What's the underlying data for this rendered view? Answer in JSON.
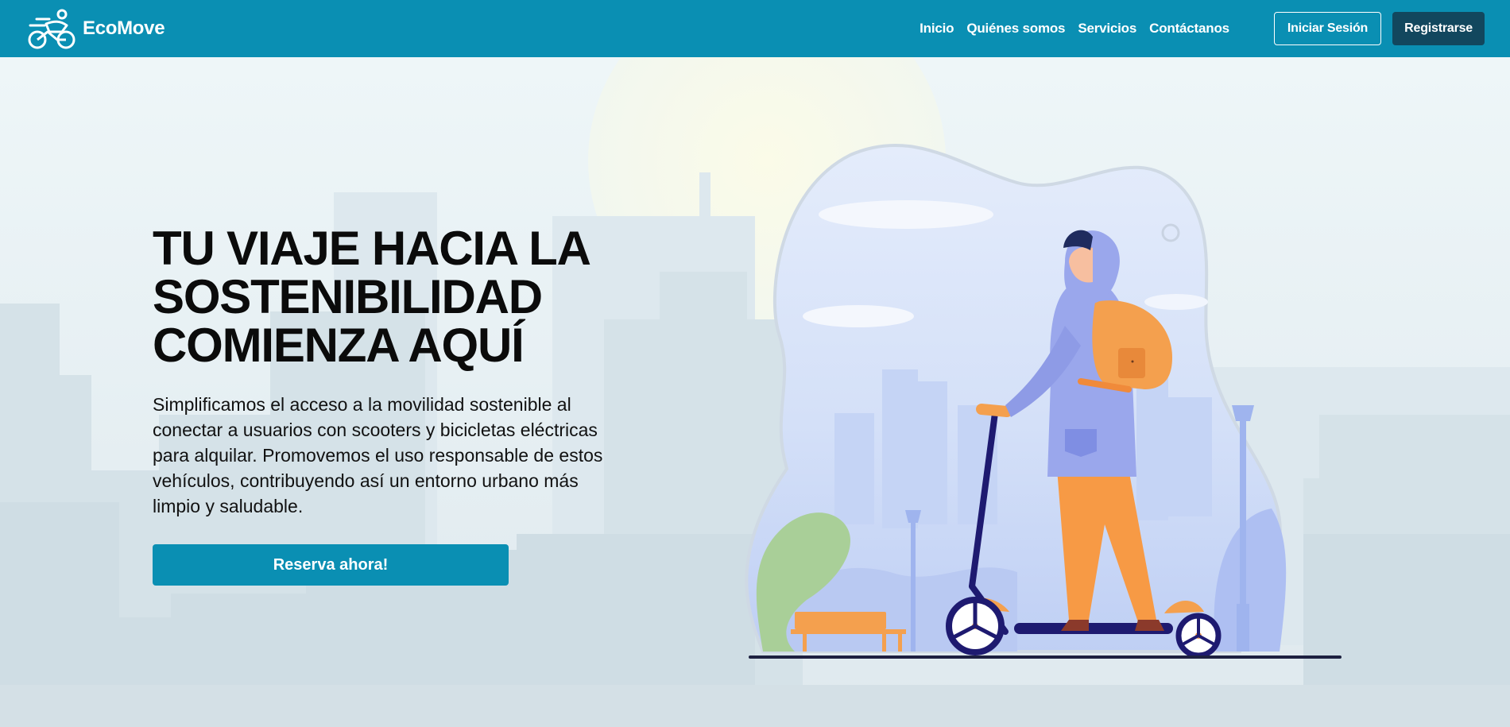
{
  "navbar": {
    "brand_name": "EcoMove",
    "links": [
      "Inicio",
      "Quiénes somos",
      "Servicios",
      "Contáctanos"
    ],
    "login_label": "Iniciar Sesión",
    "register_label": "Registrarse"
  },
  "hero": {
    "title_lines": [
      "TU VIAJE HACIA LA",
      "SOSTENIBILIDAD",
      "COMIENZA AQUÍ"
    ],
    "description": "Simplificamos el acceso a la movilidad sostenible al conectar a usuarios con scooters y bicicletas eléctricas para alquilar. Promovemos el uso responsable de estos vehículos, contribuyendo así un entorno urbano más limpio y saludable.",
    "cta_label": "Reserva ahora!"
  },
  "colors": {
    "primary": "#0a8fb3",
    "dark": "#12475e",
    "background": "#dde7ec"
  }
}
